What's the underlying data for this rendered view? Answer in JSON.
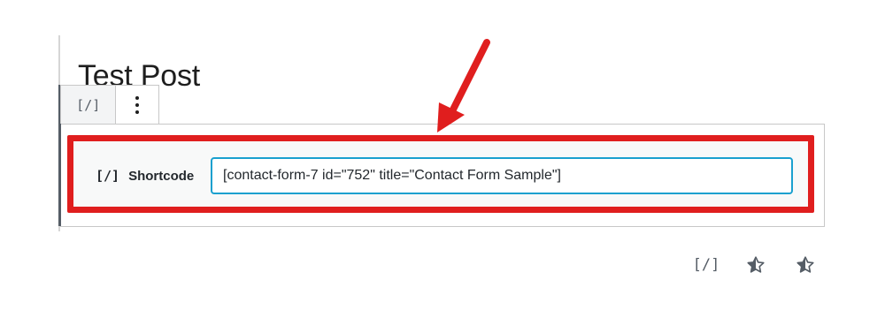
{
  "post": {
    "title": "Test Post"
  },
  "block_toolbar": {
    "block_type_glyph": "[/]",
    "more_options_icon": "vertical-ellipsis-icon"
  },
  "shortcode_block": {
    "glyph": "[/]",
    "label": "Shortcode",
    "value": "[contact-form-7 id=\"752\" title=\"Contact Form Sample\"]"
  },
  "inserter_icons": {
    "shortcode_glyph": "[/]",
    "icons": [
      "half-star-icon",
      "half-star-icon"
    ]
  },
  "colors": {
    "highlight": "#e01e1e",
    "input_focus": "#1aa0cf",
    "arrow": "#e01e1e"
  }
}
